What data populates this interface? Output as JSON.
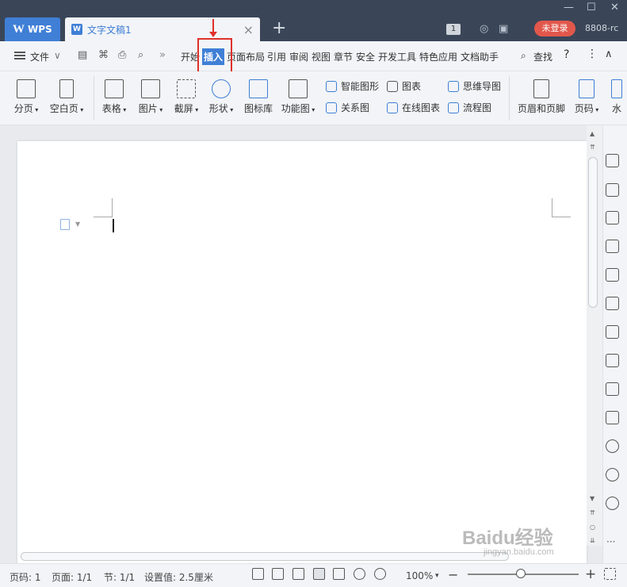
{
  "titlebar": {
    "app_tab": "WPS",
    "doc_tab": "文字文稿1",
    "badge_count": "1",
    "login_label": "未登录",
    "user_id": "8808-rc"
  },
  "menubar": {
    "file": "文件",
    "tabs": [
      "开始",
      "插入",
      "页面布局",
      "引用",
      "审阅",
      "视图",
      "章节",
      "安全",
      "开发工具",
      "特色应用",
      "文档助手"
    ],
    "active_tab": "插入",
    "search": "查找"
  },
  "ribbon": {
    "page_break": "分页",
    "blank_page": "空白页",
    "table": "表格",
    "picture": "图片",
    "screenshot": "截屏",
    "shape": "形状",
    "icon_lib": "图标库",
    "function_chart": "功能图",
    "smart_shape": "智能图形",
    "chart": "图表",
    "mind_map": "思维导图",
    "relation": "关系图",
    "online_chart": "在线图表",
    "flowchart": "流程图",
    "header_footer": "页眉和页脚",
    "page_number": "页码",
    "more": "水"
  },
  "status": {
    "page_num": "页码: 1",
    "pages": "页面: 1/1",
    "section": "节: 1/1",
    "setting": "设置值: 2.5厘米",
    "zoom": "100%"
  },
  "watermark": {
    "brand": "Baidu经验",
    "url": "jingyan.baidu.com"
  },
  "colors": {
    "accent": "#3f7fd6",
    "titlebar": "#3a4658",
    "login": "#e2574c",
    "highlight": "#e0302a"
  }
}
